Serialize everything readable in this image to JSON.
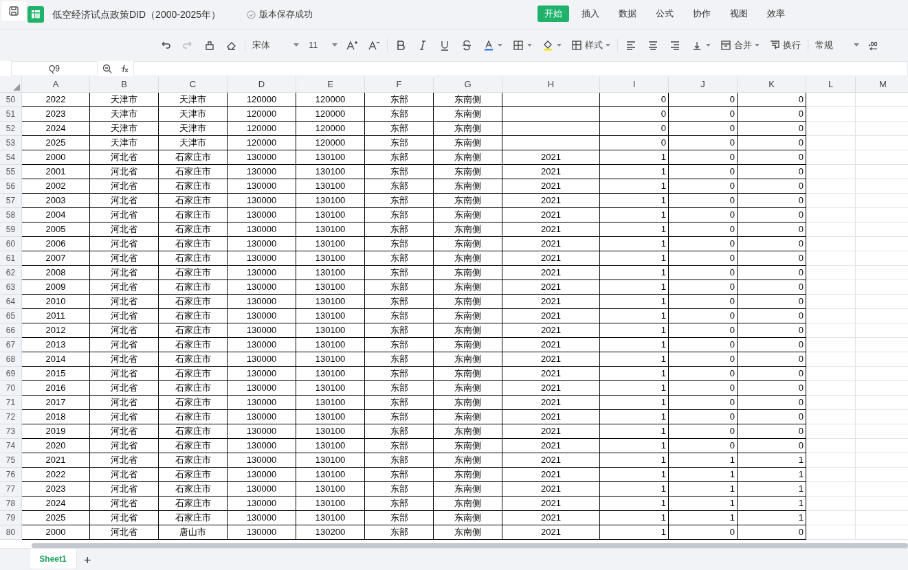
{
  "document": {
    "title": "低空经济试点政策DID（2000-2025年）",
    "save_status": "版本保存成功"
  },
  "menu_tabs": [
    {
      "label": "开始",
      "selected": true
    },
    {
      "label": "插入",
      "selected": false
    },
    {
      "label": "数据",
      "selected": false
    },
    {
      "label": "公式",
      "selected": false
    },
    {
      "label": "协作",
      "selected": false
    },
    {
      "label": "视图",
      "selected": false
    },
    {
      "label": "效率",
      "selected": false
    }
  ],
  "toolbar": {
    "font_name": "宋体",
    "font_size": "11",
    "style_label": "样式",
    "merge_label": "合并",
    "wrap_label": "换行",
    "number_format": "常规"
  },
  "formula_bar": {
    "cell_ref": "Q9"
  },
  "sheet": {
    "columns": [
      "A",
      "B",
      "C",
      "D",
      "E",
      "F",
      "G",
      "H",
      "I",
      "J",
      "K",
      "L",
      "M"
    ],
    "rows": [
      {
        "row": "50",
        "A": "2022",
        "B": "天津市",
        "C": "天津市",
        "D": "120000",
        "E": "120000",
        "F": "东部",
        "G": "东南侧",
        "I": "0",
        "J": "0",
        "K": "0"
      },
      {
        "row": "51",
        "A": "2023",
        "B": "天津市",
        "C": "天津市",
        "D": "120000",
        "E": "120000",
        "F": "东部",
        "G": "东南侧",
        "I": "0",
        "J": "0",
        "K": "0"
      },
      {
        "row": "52",
        "A": "2024",
        "B": "天津市",
        "C": "天津市",
        "D": "120000",
        "E": "120000",
        "F": "东部",
        "G": "东南侧",
        "I": "0",
        "J": "0",
        "K": "0"
      },
      {
        "row": "53",
        "A": "2025",
        "B": "天津市",
        "C": "天津市",
        "D": "120000",
        "E": "120000",
        "F": "东部",
        "G": "东南侧",
        "I": "0",
        "J": "0",
        "K": "0"
      },
      {
        "row": "54",
        "A": "2000",
        "B": "河北省",
        "C": "石家庄市",
        "D": "130000",
        "E": "130100",
        "F": "东部",
        "G": "东南侧",
        "H": "2021",
        "I": "1",
        "J": "0",
        "K": "0"
      },
      {
        "row": "55",
        "A": "2001",
        "B": "河北省",
        "C": "石家庄市",
        "D": "130000",
        "E": "130100",
        "F": "东部",
        "G": "东南侧",
        "H": "2021",
        "I": "1",
        "J": "0",
        "K": "0"
      },
      {
        "row": "56",
        "A": "2002",
        "B": "河北省",
        "C": "石家庄市",
        "D": "130000",
        "E": "130100",
        "F": "东部",
        "G": "东南侧",
        "H": "2021",
        "I": "1",
        "J": "0",
        "K": "0"
      },
      {
        "row": "57",
        "A": "2003",
        "B": "河北省",
        "C": "石家庄市",
        "D": "130000",
        "E": "130100",
        "F": "东部",
        "G": "东南侧",
        "H": "2021",
        "I": "1",
        "J": "0",
        "K": "0"
      },
      {
        "row": "58",
        "A": "2004",
        "B": "河北省",
        "C": "石家庄市",
        "D": "130000",
        "E": "130100",
        "F": "东部",
        "G": "东南侧",
        "H": "2021",
        "I": "1",
        "J": "0",
        "K": "0"
      },
      {
        "row": "59",
        "A": "2005",
        "B": "河北省",
        "C": "石家庄市",
        "D": "130000",
        "E": "130100",
        "F": "东部",
        "G": "东南侧",
        "H": "2021",
        "I": "1",
        "J": "0",
        "K": "0"
      },
      {
        "row": "60",
        "A": "2006",
        "B": "河北省",
        "C": "石家庄市",
        "D": "130000",
        "E": "130100",
        "F": "东部",
        "G": "东南侧",
        "H": "2021",
        "I": "1",
        "J": "0",
        "K": "0"
      },
      {
        "row": "61",
        "A": "2007",
        "B": "河北省",
        "C": "石家庄市",
        "D": "130000",
        "E": "130100",
        "F": "东部",
        "G": "东南侧",
        "H": "2021",
        "I": "1",
        "J": "0",
        "K": "0"
      },
      {
        "row": "62",
        "A": "2008",
        "B": "河北省",
        "C": "石家庄市",
        "D": "130000",
        "E": "130100",
        "F": "东部",
        "G": "东南侧",
        "H": "2021",
        "I": "1",
        "J": "0",
        "K": "0"
      },
      {
        "row": "63",
        "A": "2009",
        "B": "河北省",
        "C": "石家庄市",
        "D": "130000",
        "E": "130100",
        "F": "东部",
        "G": "东南侧",
        "H": "2021",
        "I": "1",
        "J": "0",
        "K": "0"
      },
      {
        "row": "64",
        "A": "2010",
        "B": "河北省",
        "C": "石家庄市",
        "D": "130000",
        "E": "130100",
        "F": "东部",
        "G": "东南侧",
        "H": "2021",
        "I": "1",
        "J": "0",
        "K": "0"
      },
      {
        "row": "65",
        "A": "2011",
        "B": "河北省",
        "C": "石家庄市",
        "D": "130000",
        "E": "130100",
        "F": "东部",
        "G": "东南侧",
        "H": "2021",
        "I": "1",
        "J": "0",
        "K": "0"
      },
      {
        "row": "66",
        "A": "2012",
        "B": "河北省",
        "C": "石家庄市",
        "D": "130000",
        "E": "130100",
        "F": "东部",
        "G": "东南侧",
        "H": "2021",
        "I": "1",
        "J": "0",
        "K": "0"
      },
      {
        "row": "67",
        "A": "2013",
        "B": "河北省",
        "C": "石家庄市",
        "D": "130000",
        "E": "130100",
        "F": "东部",
        "G": "东南侧",
        "H": "2021",
        "I": "1",
        "J": "0",
        "K": "0"
      },
      {
        "row": "68",
        "A": "2014",
        "B": "河北省",
        "C": "石家庄市",
        "D": "130000",
        "E": "130100",
        "F": "东部",
        "G": "东南侧",
        "H": "2021",
        "I": "1",
        "J": "0",
        "K": "0"
      },
      {
        "row": "69",
        "A": "2015",
        "B": "河北省",
        "C": "石家庄市",
        "D": "130000",
        "E": "130100",
        "F": "东部",
        "G": "东南侧",
        "H": "2021",
        "I": "1",
        "J": "0",
        "K": "0"
      },
      {
        "row": "70",
        "A": "2016",
        "B": "河北省",
        "C": "石家庄市",
        "D": "130000",
        "E": "130100",
        "F": "东部",
        "G": "东南侧",
        "H": "2021",
        "I": "1",
        "J": "0",
        "K": "0"
      },
      {
        "row": "71",
        "A": "2017",
        "B": "河北省",
        "C": "石家庄市",
        "D": "130000",
        "E": "130100",
        "F": "东部",
        "G": "东南侧",
        "H": "2021",
        "I": "1",
        "J": "0",
        "K": "0"
      },
      {
        "row": "72",
        "A": "2018",
        "B": "河北省",
        "C": "石家庄市",
        "D": "130000",
        "E": "130100",
        "F": "东部",
        "G": "东南侧",
        "H": "2021",
        "I": "1",
        "J": "0",
        "K": "0"
      },
      {
        "row": "73",
        "A": "2019",
        "B": "河北省",
        "C": "石家庄市",
        "D": "130000",
        "E": "130100",
        "F": "东部",
        "G": "东南侧",
        "H": "2021",
        "I": "1",
        "J": "0",
        "K": "0"
      },
      {
        "row": "74",
        "A": "2020",
        "B": "河北省",
        "C": "石家庄市",
        "D": "130000",
        "E": "130100",
        "F": "东部",
        "G": "东南侧",
        "H": "2021",
        "I": "1",
        "J": "0",
        "K": "0"
      },
      {
        "row": "75",
        "A": "2021",
        "B": "河北省",
        "C": "石家庄市",
        "D": "130000",
        "E": "130100",
        "F": "东部",
        "G": "东南侧",
        "H": "2021",
        "I": "1",
        "J": "1",
        "K": "1"
      },
      {
        "row": "76",
        "A": "2022",
        "B": "河北省",
        "C": "石家庄市",
        "D": "130000",
        "E": "130100",
        "F": "东部",
        "G": "东南侧",
        "H": "2021",
        "I": "1",
        "J": "1",
        "K": "1"
      },
      {
        "row": "77",
        "A": "2023",
        "B": "河北省",
        "C": "石家庄市",
        "D": "130000",
        "E": "130100",
        "F": "东部",
        "G": "东南侧",
        "H": "2021",
        "I": "1",
        "J": "1",
        "K": "1"
      },
      {
        "row": "78",
        "A": "2024",
        "B": "河北省",
        "C": "石家庄市",
        "D": "130000",
        "E": "130100",
        "F": "东部",
        "G": "东南侧",
        "H": "2021",
        "I": "1",
        "J": "1",
        "K": "1"
      },
      {
        "row": "79",
        "A": "2025",
        "B": "河北省",
        "C": "石家庄市",
        "D": "130000",
        "E": "130100",
        "F": "东部",
        "G": "东南侧",
        "H": "2021",
        "I": "1",
        "J": "1",
        "K": "1"
      },
      {
        "row": "80",
        "A": "2000",
        "B": "河北省",
        "C": "唐山市",
        "D": "130000",
        "E": "130200",
        "F": "东部",
        "G": "东南侧",
        "H": "2021",
        "I": "1",
        "J": "0",
        "K": "0"
      }
    ]
  },
  "sheet_tabs": [
    {
      "label": "Sheet1",
      "selected": true
    }
  ],
  "add_sheet": "+"
}
